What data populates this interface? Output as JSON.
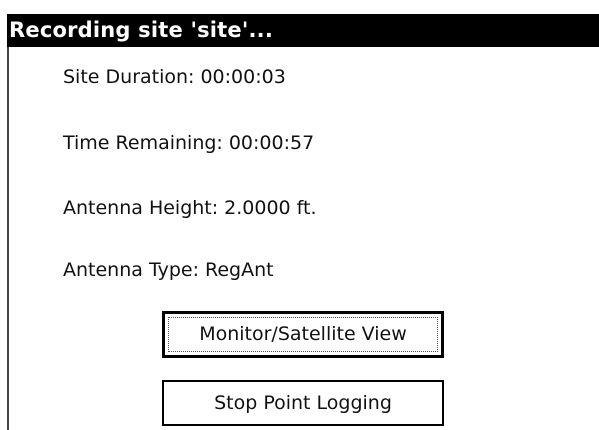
{
  "title": "Recording site 'site'...",
  "fields": {
    "site_duration": {
      "label": "Site Duration:",
      "value": "00:00:03"
    },
    "time_remaining": {
      "label": "Time Remaining:",
      "value": "00:00:57"
    },
    "antenna_height": {
      "label": "Antenna Height:",
      "value": "2.0000 ft."
    },
    "antenna_type": {
      "label": "Antenna Type:",
      "value": "RegAnt"
    }
  },
  "buttons": {
    "monitor_satellite_view": "Monitor/Satellite View",
    "stop_point_logging": "Stop Point Logging"
  },
  "colors": {
    "title_bar_background": "#000000",
    "title_bar_text": "#ffffff",
    "background": "#ffffff",
    "text": "#111111"
  }
}
